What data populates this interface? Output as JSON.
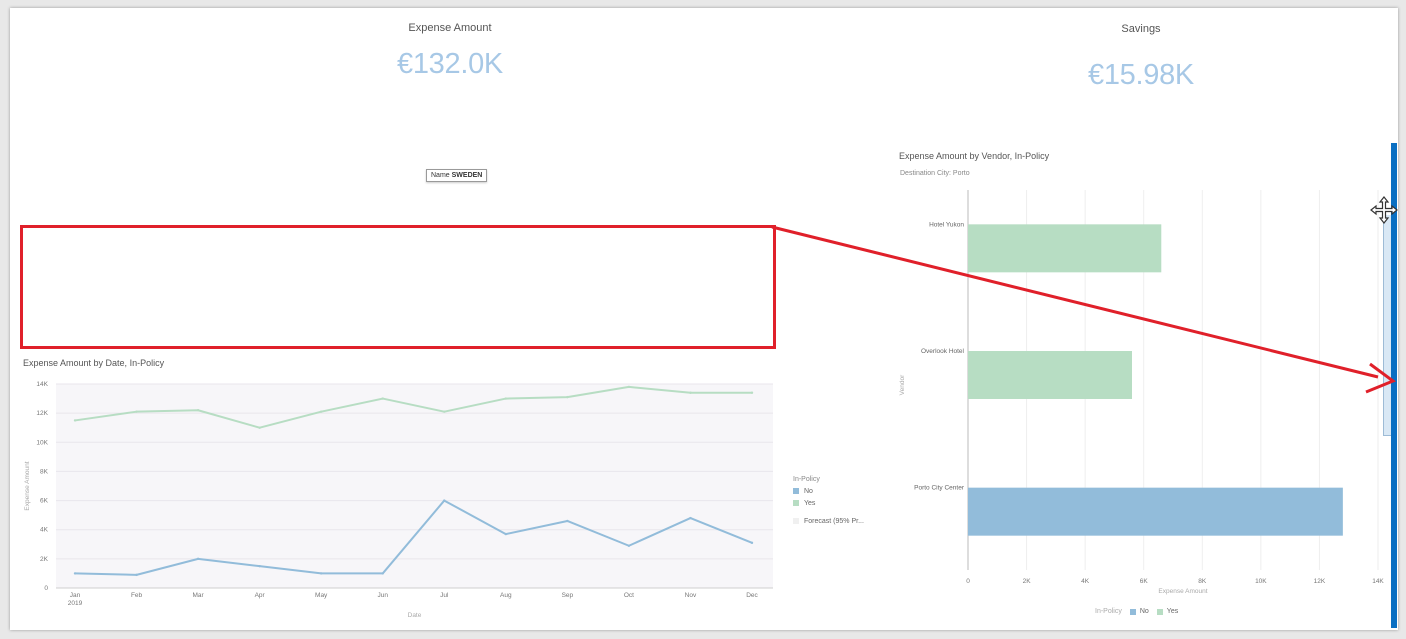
{
  "kpis": {
    "expense": {
      "label": "Expense Amount",
      "value": "€132.0K"
    },
    "savings": {
      "label": "Savings",
      "value": "€15.98K"
    }
  },
  "tooltip": {
    "key": "Name",
    "value": "SWEDEN"
  },
  "colors": {
    "no": "#92bcda",
    "yes": "#b7ddc3",
    "forecast": "#f0f0f0",
    "annotation": "#e0202a",
    "selection": "#0a6fc2",
    "kpi_value": "#a7c8e6"
  },
  "line_chart": {
    "title": "Expense Amount by Date, In-Policy",
    "legend_title": "In-Policy",
    "legend": [
      {
        "label": "No",
        "color": "#92bcda"
      },
      {
        "label": "Yes",
        "color": "#b7ddc3"
      },
      {
        "label": "Forecast (95% Pr...",
        "color": "#f0f0f0"
      }
    ]
  },
  "bar_chart": {
    "title": "Expense Amount by Vendor, In-Policy",
    "subtitle": "Destination City: Porto",
    "legend_title": "In-Policy",
    "legend": [
      {
        "label": "No",
        "color": "#92bcda"
      },
      {
        "label": "Yes",
        "color": "#b7ddc3"
      }
    ]
  },
  "chart_data": [
    {
      "type": "line",
      "title": "Expense Amount by Date, In-Policy",
      "xlabel": "Date",
      "ylabel": "Expense Amount",
      "categories": [
        "Jan",
        "Feb",
        "Mar",
        "Apr",
        "May",
        "Jun",
        "Jul",
        "Aug",
        "Sep",
        "Oct",
        "Nov",
        "Dec"
      ],
      "year_label": "2019",
      "y_ticks": [
        "0",
        "2K",
        "4K",
        "6K",
        "8K",
        "10K",
        "12K",
        "14K"
      ],
      "ylim": [
        0,
        14000
      ],
      "grid": true,
      "legend_position": "right",
      "series": [
        {
          "name": "Yes",
          "color": "#b7ddc3",
          "values": [
            11500,
            12100,
            12200,
            11000,
            12100,
            13000,
            12100,
            13000,
            13100,
            13800,
            13400,
            13400
          ]
        },
        {
          "name": "No",
          "color": "#92bcda",
          "values": [
            1000,
            900,
            2000,
            1500,
            1000,
            1000,
            6000,
            3700,
            4600,
            2900,
            4800,
            3100
          ]
        }
      ]
    },
    {
      "type": "bar",
      "orientation": "horizontal",
      "title": "Expense Amount by Vendor, In-Policy",
      "subtitle": "Destination City: Porto",
      "xlabel": "Expense Amount",
      "ylabel": "Vendor",
      "x_ticks": [
        "0",
        "2K",
        "4K",
        "6K",
        "8K",
        "10K",
        "12K",
        "14K"
      ],
      "xlim": [
        0,
        14000
      ],
      "grid": true,
      "legend_position": "bottom",
      "categories": [
        "Hotel Yukon",
        "Overlook Hotel",
        "Porto City Center"
      ],
      "values": [
        6600,
        5600,
        12800
      ],
      "series_by_category": [
        "Yes",
        "Yes",
        "No"
      ]
    }
  ]
}
